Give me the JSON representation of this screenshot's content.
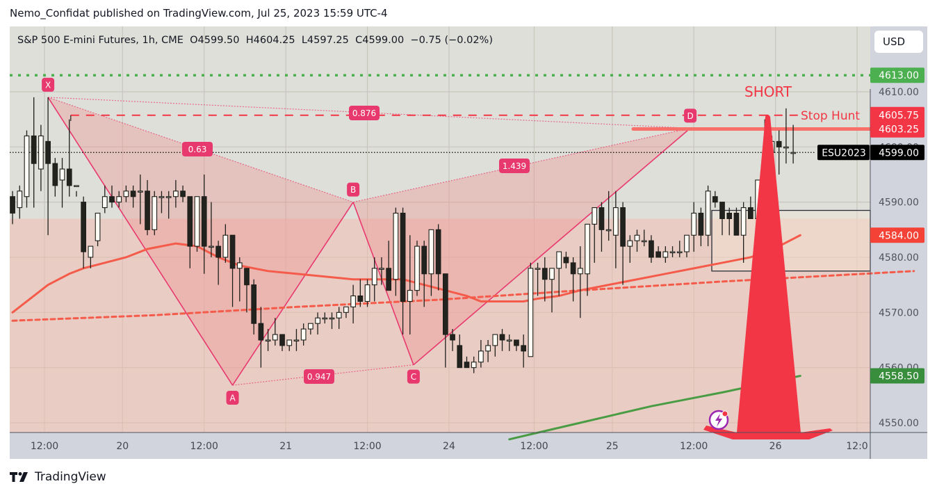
{
  "publisher_line": "Nemo_Confidat published on TradingView.com, Jul 25, 2023 15:59 UTC-4",
  "footer": {
    "logo_text": "TradingView"
  },
  "legend": {
    "symbol": "S&P 500 E-mini Futures, 1h, CME",
    "open_key": "O",
    "open": "4599.50",
    "high_key": "H",
    "high": "4604.25",
    "low_key": "L",
    "low": "4597.25",
    "close_key": "C",
    "close": "4599.00",
    "change": "−0.75 (−0.02%)"
  },
  "currency_button": "USD",
  "colors": {
    "background": "#dedfd8",
    "axis_bg": "#d1d4dc",
    "bull_body": "#fdfdf5",
    "bear_body": "#22221e",
    "pattern": "#e8396e",
    "ma_red": "#f55b4a",
    "ma_green": "#4a9c44",
    "green_level": "#4caf50",
    "short_arrow": "#f23645",
    "zone_fill": "#f6b7ac"
  },
  "chart_data": {
    "type": "candlestick",
    "title": "S&P 500 E-mini Futures, 1h, CME",
    "ylabel": "USD",
    "ylim": [
      4547,
      4621
    ],
    "y_ticks": [
      "4610.00",
      "4600.00",
      "4590.00",
      "4580.00",
      "4570.00",
      "4560.00",
      "4550.00"
    ],
    "x_ticks": [
      "12:00",
      "20",
      "12:00",
      "21",
      "12:00",
      "24",
      "12:00",
      "25",
      "12:00",
      "26",
      "12:0"
    ],
    "x_tick_index": [
      4.5,
      15.5,
      27,
      38.5,
      50,
      61.5,
      73.5,
      84.5,
      96,
      107.5,
      119
    ],
    "candles_ohlc": [
      [
        4591,
        4592,
        4586,
        4588
      ],
      [
        4589,
        4593,
        4587,
        4592
      ],
      [
        4591,
        4603,
        4589,
        4602
      ],
      [
        4602,
        4609,
        4589,
        4597
      ],
      [
        4596,
        4604,
        4592,
        4602
      ],
      [
        4601,
        4609,
        4584,
        4597
      ],
      [
        4597,
        4598,
        4591,
        4593
      ],
      [
        4594,
        4598,
        4589,
        4596
      ],
      [
        4596,
        4605,
        4591,
        4593
      ],
      [
        4593,
        4592,
        4591,
        4593
      ],
      [
        4590,
        4591,
        4578,
        4581
      ],
      [
        4580,
        4581,
        4578,
        4582
      ],
      [
        4583,
        4588,
        4582,
        4588
      ],
      [
        4589,
        4593,
        4588,
        4591
      ],
      [
        4591,
        4593,
        4589,
        4590
      ],
      [
        4590,
        4592,
        4589,
        4591
      ],
      [
        4591,
        4593,
        4590,
        4592
      ],
      [
        4592,
        4593,
        4589,
        4591
      ],
      [
        4592,
        4595,
        4586,
        4592
      ],
      [
        4592,
        4594,
        4584,
        4585
      ],
      [
        4585,
        4592,
        4584,
        4591
      ],
      [
        4591,
        4592,
        4588,
        4591
      ],
      [
        4591,
        4592,
        4587,
        4591
      ],
      [
        4591,
        4594,
        4589,
        4592
      ],
      [
        4592,
        4593,
        4590,
        4591
      ],
      [
        4591,
        4591,
        4578,
        4582
      ],
      [
        4582,
        4591,
        4581,
        4591
      ],
      [
        4591,
        4595,
        4577,
        4582
      ],
      [
        4582,
        4590,
        4580,
        4582
      ],
      [
        4582,
        4583,
        4575,
        4580
      ],
      [
        4580,
        4586,
        4579,
        4584
      ],
      [
        4584,
        4584,
        4571,
        4578
      ],
      [
        4578,
        4580,
        4572,
        4579
      ],
      [
        4578,
        4578,
        4570,
        4575
      ],
      [
        4575,
        4576,
        4566,
        4568
      ],
      [
        4568,
        4571,
        4560,
        4565
      ],
      [
        4565,
        4567,
        4563,
        4565
      ],
      [
        4565,
        4569,
        4564,
        4566
      ],
      [
        4566,
        4566,
        4563,
        4564
      ],
      [
        4564,
        4565,
        4563,
        4565
      ],
      [
        4565,
        4567,
        4563,
        4565
      ],
      [
        4565,
        4568,
        4564,
        4567
      ],
      [
        4567,
        4568,
        4566,
        4568
      ],
      [
        4568,
        4570,
        4566,
        4569
      ],
      [
        4569,
        4570,
        4568,
        4569
      ],
      [
        4569,
        4570,
        4567,
        4569
      ],
      [
        4569,
        4571,
        4567,
        4570
      ],
      [
        4570,
        4571,
        4569,
        4571
      ],
      [
        4571,
        4575,
        4568,
        4573
      ],
      [
        4573,
        4576,
        4571,
        4572
      ],
      [
        4572,
        4576,
        4571,
        4575
      ],
      [
        4575,
        4580,
        4572,
        4578
      ],
      [
        4578,
        4580,
        4575,
        4578
      ],
      [
        4578,
        4583,
        4575,
        4574
      ],
      [
        4576,
        4589,
        4573,
        4588
      ],
      [
        4588,
        4589,
        4566,
        4572
      ],
      [
        4572,
        4584,
        4566,
        4574
      ],
      [
        4574,
        4583,
        4573,
        4582
      ],
      [
        4582,
        4583,
        4571,
        4577
      ],
      [
        4577,
        4585,
        4573,
        4585
      ],
      [
        4585,
        4586,
        4574,
        4577
      ],
      [
        4577,
        4577,
        4560,
        4566
      ],
      [
        4566,
        4567,
        4563,
        4565
      ],
      [
        4564,
        4566,
        4561,
        4560
      ],
      [
        4561,
        4562,
        4560,
        4560
      ],
      [
        4560,
        4562,
        4559,
        4561
      ],
      [
        4561,
        4565,
        4560,
        4563
      ],
      [
        4563,
        4565,
        4561,
        4564
      ],
      [
        4564,
        4566,
        4562,
        4566
      ],
      [
        4566,
        4567,
        4563,
        4565
      ],
      [
        4565,
        4566,
        4563,
        4565
      ],
      [
        4565,
        4565,
        4563,
        4564
      ],
      [
        4564,
        4566,
        4560,
        4563
      ],
      [
        4562,
        4579,
        4562,
        4578
      ],
      [
        4578,
        4579,
        4573,
        4578
      ],
      [
        4578,
        4580,
        4572,
        4576
      ],
      [
        4576,
        4577,
        4570,
        4578
      ],
      [
        4578,
        4580,
        4573,
        4581
      ],
      [
        4580,
        4581,
        4578,
        4579
      ],
      [
        4579,
        4580,
        4572,
        4577
      ],
      [
        4577,
        4582,
        4569,
        4578
      ],
      [
        4577,
        4586,
        4573,
        4586
      ],
      [
        4586,
        4588,
        4579,
        4589
      ],
      [
        4589,
        4590,
        4581,
        4585
      ],
      [
        4585,
        4592,
        4583,
        4585
      ],
      [
        4584,
        4592,
        4578,
        4589
      ],
      [
        4589,
        4590,
        4575,
        4582
      ],
      [
        4582,
        4584,
        4579,
        4583
      ],
      [
        4583,
        4585,
        4581,
        4584
      ],
      [
        4583,
        4585,
        4582,
        4583
      ],
      [
        4583,
        4584,
        4579,
        4580
      ],
      [
        4581,
        4582,
        4580,
        4580
      ],
      [
        4580,
        4582,
        4579,
        4581
      ],
      [
        4581,
        4582,
        4580,
        4581
      ],
      [
        4581,
        4583,
        4580,
        4581
      ],
      [
        4581,
        4584,
        4580,
        4584
      ],
      [
        4584,
        4590,
        4581,
        4588
      ],
      [
        4588,
        4589,
        4582,
        4584
      ],
      [
        4584,
        4593,
        4582,
        4592
      ],
      [
        4591,
        4592,
        4589,
        4590
      ],
      [
        4590,
        4590,
        4584,
        4587
      ],
      [
        4588,
        4589,
        4584,
        4587
      ],
      [
        4588,
        4589,
        4584,
        4584
      ],
      [
        4584,
        4590,
        4579,
        4589
      ],
      [
        4589,
        4591,
        4587,
        4587
      ],
      [
        4587,
        4594,
        4586,
        4594
      ],
      [
        4594,
        4605,
        4593,
        4599
      ],
      [
        4599,
        4602,
        4596,
        4601
      ],
      [
        4601,
        4603,
        4595,
        4600
      ],
      [
        4600,
        4607,
        4597,
        4600
      ],
      [
        4599,
        4604,
        4597,
        4599
      ]
    ],
    "moving_averages": [
      {
        "name": "MA (red solid)",
        "color": "#f55b4a",
        "points": [
          [
            0,
            4570
          ],
          [
            2,
            4572
          ],
          [
            5,
            4575
          ],
          [
            8,
            4577
          ],
          [
            10,
            4578
          ],
          [
            13,
            4579
          ],
          [
            16,
            4580
          ],
          [
            19,
            4581.5
          ],
          [
            23,
            4582.5
          ],
          [
            26,
            4582
          ],
          [
            29,
            4580
          ],
          [
            32,
            4578.5
          ],
          [
            36,
            4577.5
          ],
          [
            40,
            4577
          ],
          [
            44,
            4576.5
          ],
          [
            48,
            4576
          ],
          [
            52,
            4576
          ],
          [
            55,
            4576
          ],
          [
            58,
            4575
          ],
          [
            61,
            4574
          ],
          [
            64,
            4573
          ],
          [
            66,
            4572
          ],
          [
            68,
            4572
          ],
          [
            72,
            4572
          ],
          [
            74,
            4572.5
          ],
          [
            77,
            4573
          ],
          [
            80,
            4574
          ],
          [
            84,
            4575
          ],
          [
            88,
            4576
          ],
          [
            92,
            4577
          ],
          [
            96,
            4578
          ],
          [
            100,
            4579
          ],
          [
            104,
            4580
          ],
          [
            108,
            4582
          ],
          [
            111,
            4584
          ]
        ]
      },
      {
        "name": "MA (red dashed)",
        "color": "#f55b4a",
        "dashed": true,
        "points": [
          [
            0,
            4568.5
          ],
          [
            20,
            4569.5
          ],
          [
            40,
            4571
          ],
          [
            60,
            4572.3
          ],
          [
            80,
            4574
          ],
          [
            100,
            4575.6
          ],
          [
            127,
            4577.5
          ]
        ]
      },
      {
        "name": "MA (green)",
        "color": "#4a9c44",
        "points": [
          [
            70,
            4547
          ],
          [
            80,
            4550
          ],
          [
            90,
            4553
          ],
          [
            100,
            4555.5
          ],
          [
            111,
            4558.5
          ]
        ]
      }
    ],
    "harmonic_pattern": {
      "points": [
        {
          "label": "X",
          "index": 5,
          "price": 4609
        },
        {
          "label": "A",
          "index": 31,
          "price": 4556.8
        },
        {
          "label": "B",
          "index": 48,
          "price": 4590
        },
        {
          "label": "C",
          "index": 56.5,
          "price": 4560.5
        },
        {
          "label": "D",
          "index": 95.5,
          "price": 4603.4
        }
      ],
      "ratios": [
        {
          "label": "0.63",
          "between": "XB"
        },
        {
          "label": "0.947",
          "between": "AC"
        },
        {
          "label": "1.439",
          "between": "BD"
        },
        {
          "label": "0.876",
          "between": "XD"
        }
      ]
    },
    "horizontal_levels": [
      {
        "name": "green dotted level",
        "price": 4613.0,
        "tag": "4613.00",
        "color": "#4caf50",
        "style": "dotted"
      },
      {
        "name": "stop hunt dashed",
        "price": 4605.75,
        "tag": "4605.75",
        "color": "#f23645",
        "style": "dashed",
        "label": "Stop Hunt"
      },
      {
        "name": "resistance line",
        "price": 4603.25,
        "tag": "4603.25",
        "color": "#f7706a",
        "style": "solid"
      },
      {
        "name": "last price",
        "price": 4599.0,
        "tag": "4599.00",
        "color": "#000000",
        "style": "dotted",
        "symbol": "ESU2023"
      },
      {
        "name": "red MA value",
        "price": 4584.0,
        "tag": "4584.00",
        "color": "#f44336"
      },
      {
        "name": "green MA value",
        "price": 4558.5,
        "tag": "4558.50",
        "color": "#388e3c"
      }
    ],
    "annotations": [
      {
        "text": "SHORT",
        "type": "text"
      },
      {
        "text": "Stop Hunt",
        "type": "text"
      },
      {
        "type": "short-arrow",
        "from_price": 4605.75,
        "to_price": 4547
      }
    ],
    "zones": [
      {
        "name": "demand/pattern zone",
        "from_price": 4547,
        "to_price": 4587
      },
      {
        "name": "rectangle box",
        "from_price": 4577.5,
        "to_price": 4588.5
      }
    ]
  }
}
